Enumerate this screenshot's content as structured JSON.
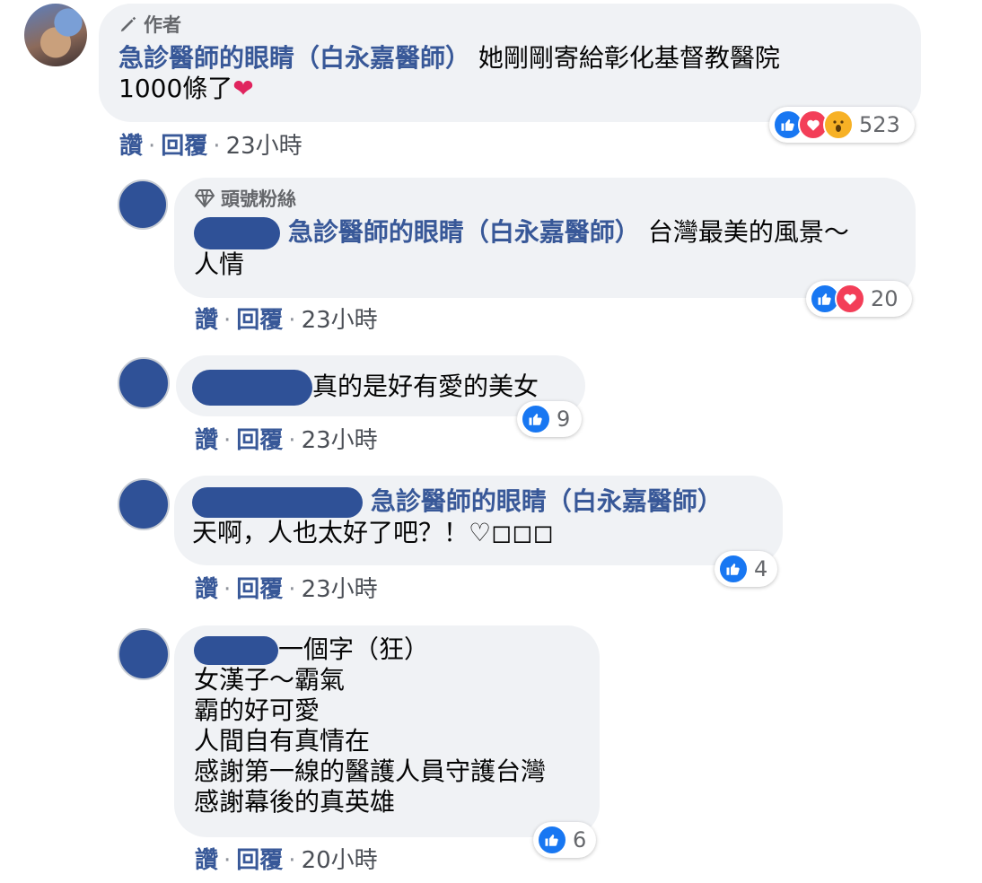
{
  "author_badge": "作者",
  "top_fan_badge": "頭號粉絲",
  "actions": {
    "like": "讚",
    "reply": "回覆"
  },
  "comments": [
    {
      "tag": "急診醫師的眼睛（白永嘉醫師）",
      "text1": "她剛剛寄給彰化基督教醫院",
      "text2": "1000條了",
      "time": "23小時",
      "reactions": "523"
    },
    {
      "tag": "急診醫師的眼睛（白永嘉醫師）",
      "text1": "台灣最美的風景～",
      "text2": "人情",
      "time": "23小時",
      "reactions": "20"
    },
    {
      "text1": "真的是好有愛的美女",
      "time": "23小時",
      "reactions": "9"
    },
    {
      "tag": "急診醫師的眼睛（白永嘉醫師）",
      "text1": "天啊，人也太好了吧？！♡◻◻◻",
      "time": "23小時",
      "reactions": "4"
    },
    {
      "lines": [
        "一個字（狂）",
        "女漢子～霸氣",
        "霸的好可愛",
        "人間自有真情在",
        "感謝第一線的醫護人員守護台灣",
        "感謝幕後的真英雄"
      ],
      "time": "20小時",
      "reactions": "6"
    }
  ],
  "colors": {
    "name_blue": "#385898",
    "bubble_bg": "#f0f2f5",
    "like_blue": "#1877f2",
    "love_red": "#f33e58",
    "avatar_blue": "#2f5197"
  }
}
